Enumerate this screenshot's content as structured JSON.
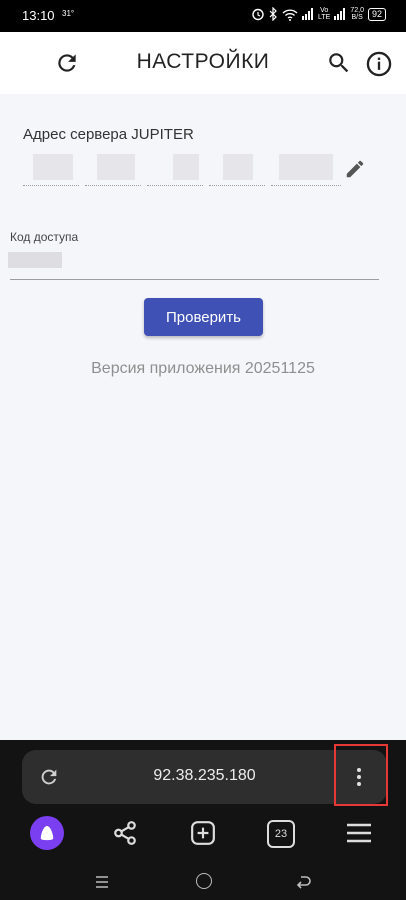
{
  "status_bar": {
    "time": "13:10",
    "temperature": "31°",
    "network_speed_top": "72,0",
    "network_speed_bottom": "B/S",
    "network_type_top": "Vo",
    "network_type_bottom": "LTE",
    "battery": "92"
  },
  "header": {
    "title": "НАСТРОЙКИ",
    "refresh_icon": "refresh-icon",
    "search_icon": "search-icon",
    "info_icon": "info-icon"
  },
  "settings": {
    "server_label": "Адрес сервера JUPITER",
    "code_label": "Код доступа",
    "check_button": "Проверить",
    "version": "Версия приложения 20251125"
  },
  "browser": {
    "url": "92.38.235.180",
    "tab_count": "23",
    "accent_color": "#7b3ff2"
  },
  "colors": {
    "primary_button": "#3f51b5",
    "highlight": "#e53935"
  }
}
